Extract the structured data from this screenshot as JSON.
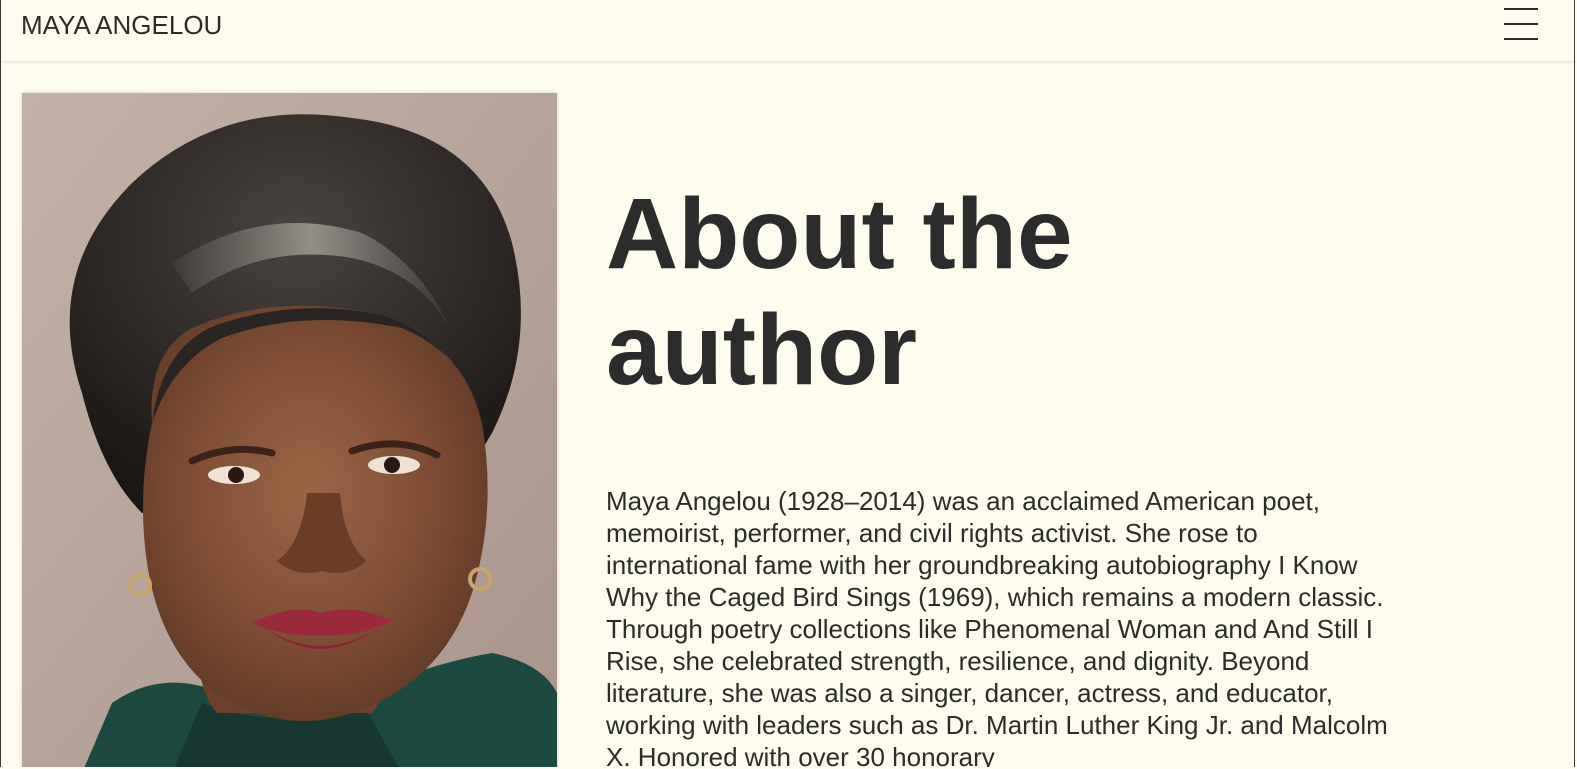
{
  "header": {
    "brand": "MAYA ANGELOU",
    "menu_icon": "hamburger-menu-icon"
  },
  "portrait": {
    "alt": "Portrait of Maya Angelou"
  },
  "main": {
    "heading": "About the author",
    "bio": "Maya Angelou (1928–2014) was an acclaimed American poet, memoirist, performer, and civil rights activist. She rose to international fame with her groundbreaking autobiography I Know Why the Caged Bird Sings (1969), which remains a modern classic. Through poetry collections like Phenomenal Woman and And Still I Rise, she celebrated strength, resilience, and dignity. Beyond literature, she was also a singer, dancer, actress, and educator, working with leaders such as Dr. Martin Luther King Jr. and Malcolm X. Honored with over 30 honorary"
  },
  "colors": {
    "background": "#fefcee",
    "text": "#2c2c2c"
  }
}
